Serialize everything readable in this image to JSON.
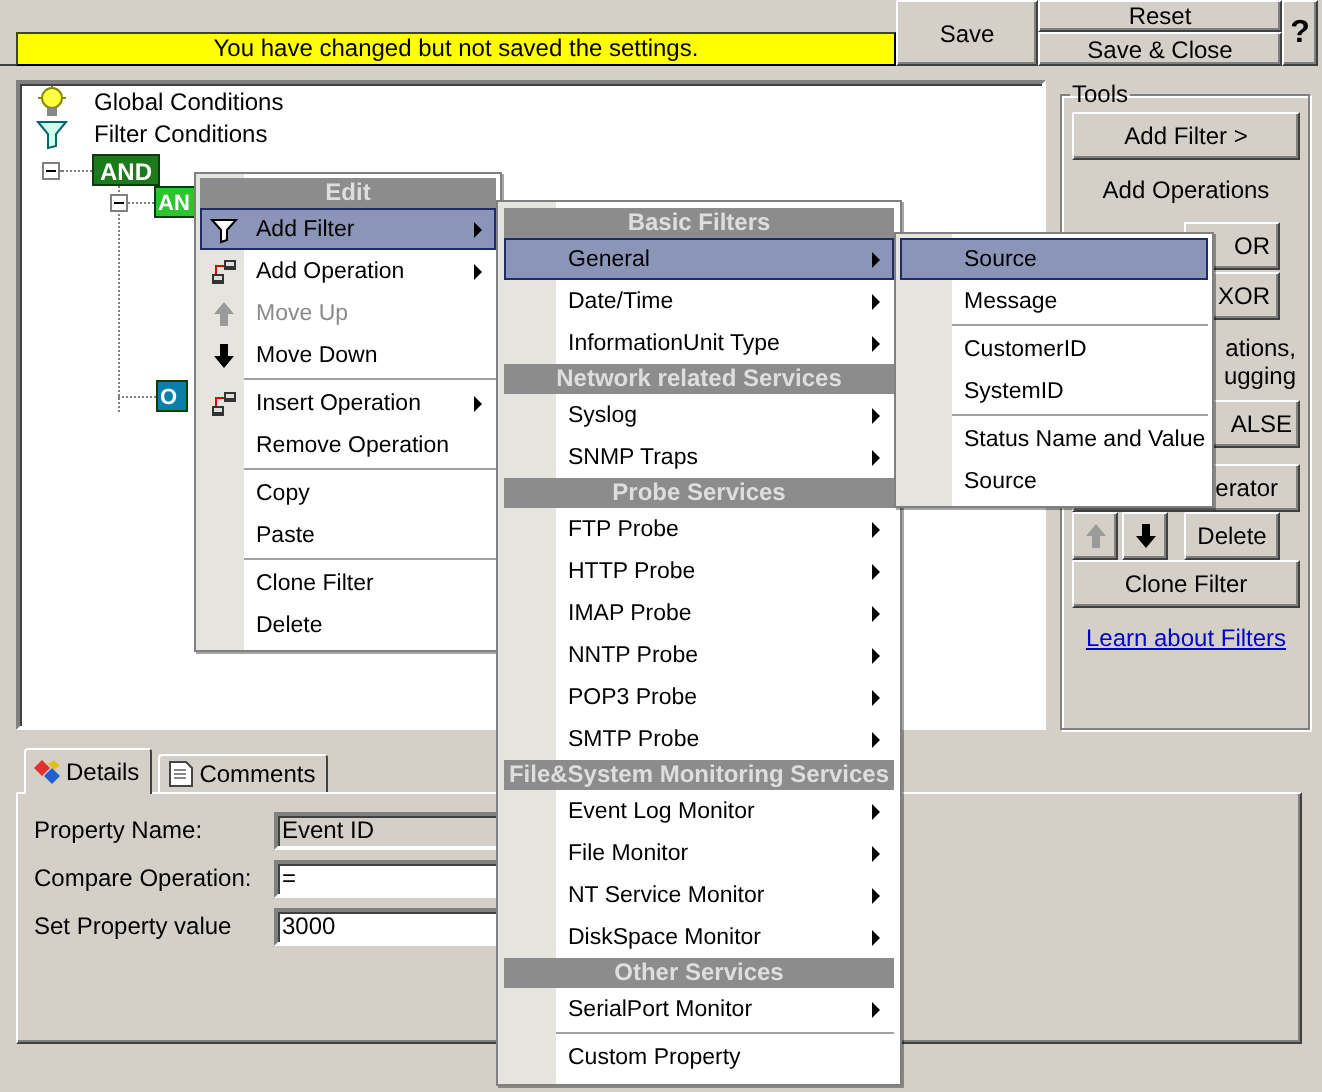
{
  "notice": "You have changed but not saved the settings.",
  "save_button": "Save",
  "reset_button": "Reset",
  "save_close_button": "Save & Close",
  "help_button": "?",
  "tree": {
    "items": [
      {
        "kind": "global",
        "label": "Global Conditions"
      },
      {
        "kind": "filter",
        "label": "Filter Conditions"
      }
    ],
    "operations": [
      {
        "label": "AND",
        "color": "#1c7a1c",
        "expanded": true,
        "children": [
          {
            "label": "AN",
            "color": "#2ec42e",
            "expanded": true
          },
          {
            "label": "O",
            "color": "#0a80a8"
          }
        ]
      }
    ]
  },
  "tools": {
    "title": "Tools",
    "add_filter_button": "Add Filter >",
    "add_operations_label": "Add Operations",
    "operation_buttons": [
      "OR",
      "XOR"
    ],
    "note_lines": [
      "ations,",
      "ugging"
    ],
    "false_button": "ALSE",
    "operator_button": "erator",
    "move_buttons": [
      {
        "kind": "up",
        "disabled": true
      },
      {
        "kind": "down",
        "disabled": false
      }
    ],
    "delete_button": "Delete",
    "clone_button": "Clone Filter",
    "link": "Learn about Filters"
  },
  "tabs": [
    {
      "label": "Details",
      "selected": true
    },
    {
      "label": "Comments",
      "selected": false
    }
  ],
  "properties": [
    {
      "label": "Property Name:",
      "value": "Event ID",
      "disabled": true
    },
    {
      "label": "Compare Operation:",
      "value": "=",
      "disabled": false
    },
    {
      "label": "Set Property value",
      "value": "3000",
      "disabled": false
    }
  ],
  "menus": [
    {
      "items": [
        {
          "kind": "header",
          "label": "Edit"
        },
        {
          "kind": "item",
          "label": "Add Filter",
          "selected": true,
          "disabled": false,
          "submenu": true
        },
        {
          "kind": "item",
          "label": "Add Operation",
          "selected": false,
          "disabled": false,
          "submenu": true
        },
        {
          "kind": "item",
          "label": "Move Up",
          "selected": false,
          "disabled": true,
          "submenu": false
        },
        {
          "kind": "item",
          "label": "Move Down",
          "selected": false,
          "disabled": false,
          "submenu": false
        },
        {
          "kind": "separator"
        },
        {
          "kind": "item",
          "label": "Insert Operation",
          "selected": false,
          "disabled": false,
          "submenu": true
        },
        {
          "kind": "item",
          "label": "Remove Operation",
          "selected": false,
          "disabled": false,
          "submenu": false
        },
        {
          "kind": "separator"
        },
        {
          "kind": "item",
          "label": "Copy",
          "selected": false,
          "disabled": false,
          "submenu": false
        },
        {
          "kind": "item",
          "label": "Paste",
          "selected": false,
          "disabled": false,
          "submenu": false
        },
        {
          "kind": "separator"
        },
        {
          "kind": "item",
          "label": "Clone Filter",
          "selected": false,
          "disabled": false,
          "submenu": false
        },
        {
          "kind": "item",
          "label": "Delete",
          "selected": false,
          "disabled": false,
          "submenu": false
        }
      ]
    },
    {
      "items": [
        {
          "kind": "header",
          "label": "Basic Filters"
        },
        {
          "kind": "item",
          "label": "General",
          "selected": true,
          "submenu": true
        },
        {
          "kind": "item",
          "label": "Date/Time",
          "selected": false,
          "submenu": true
        },
        {
          "kind": "item",
          "label": "InformationUnit Type",
          "selected": false,
          "submenu": true
        },
        {
          "kind": "header",
          "label": "Network related Services"
        },
        {
          "kind": "item",
          "label": "Syslog",
          "selected": false,
          "submenu": true
        },
        {
          "kind": "item",
          "label": "SNMP Traps",
          "selected": false,
          "submenu": true
        },
        {
          "kind": "header",
          "label": "Probe Services"
        },
        {
          "kind": "item",
          "label": "FTP Probe",
          "selected": false,
          "submenu": true
        },
        {
          "kind": "item",
          "label": "HTTP Probe",
          "selected": false,
          "submenu": true
        },
        {
          "kind": "item",
          "label": "IMAP Probe",
          "selected": false,
          "submenu": true
        },
        {
          "kind": "item",
          "label": "NNTP Probe",
          "selected": false,
          "submenu": true
        },
        {
          "kind": "item",
          "label": "POP3 Probe",
          "selected": false,
          "submenu": true
        },
        {
          "kind": "item",
          "label": "SMTP Probe",
          "selected": false,
          "submenu": true
        },
        {
          "kind": "header",
          "label": "File&System Monitoring Services"
        },
        {
          "kind": "item",
          "label": "Event Log Monitor",
          "selected": false,
          "submenu": true
        },
        {
          "kind": "item",
          "label": "File Monitor",
          "selected": false,
          "submenu": true
        },
        {
          "kind": "item",
          "label": "NT Service Monitor",
          "selected": false,
          "submenu": true
        },
        {
          "kind": "item",
          "label": "DiskSpace Monitor",
          "selected": false,
          "submenu": true
        },
        {
          "kind": "header",
          "label": "Other Services"
        },
        {
          "kind": "item",
          "label": "SerialPort Monitor",
          "selected": false,
          "submenu": true
        },
        {
          "kind": "separator"
        },
        {
          "kind": "item",
          "label": "Custom Property",
          "selected": false,
          "submenu": false
        }
      ]
    },
    {
      "items": [
        {
          "kind": "item",
          "label": "Source",
          "selected": true,
          "submenu": false
        },
        {
          "kind": "item",
          "label": "Message",
          "selected": false,
          "submenu": false
        },
        {
          "kind": "separator"
        },
        {
          "kind": "item",
          "label": "CustomerID",
          "selected": false,
          "submenu": false
        },
        {
          "kind": "item",
          "label": "SystemID",
          "selected": false,
          "submenu": false
        },
        {
          "kind": "separator"
        },
        {
          "kind": "item",
          "label": "Status Name and Value",
          "selected": false,
          "submenu": false
        },
        {
          "kind": "item",
          "label": "Source",
          "selected": false,
          "submenu": false
        }
      ]
    }
  ]
}
